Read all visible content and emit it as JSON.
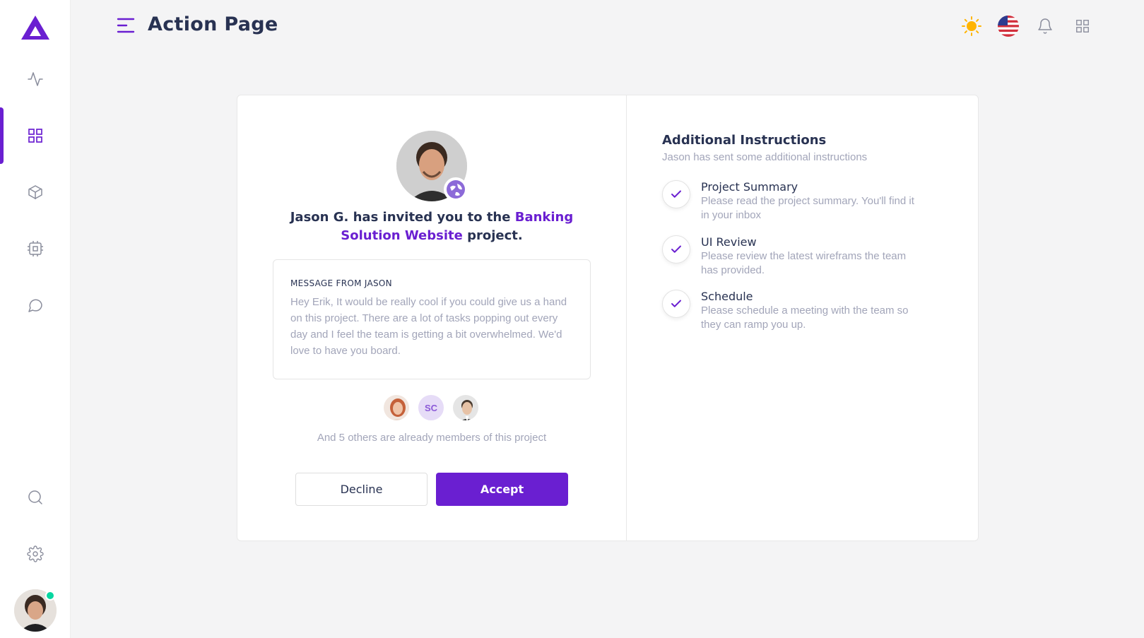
{
  "header": {
    "title": "Action Page"
  },
  "sidebar": {
    "items": [
      {
        "name": "activity",
        "icon": "activity-icon"
      },
      {
        "name": "dashboard",
        "icon": "grid-icon",
        "active": true
      },
      {
        "name": "box",
        "icon": "box-icon"
      },
      {
        "name": "cpu",
        "icon": "cpu-icon"
      },
      {
        "name": "messages",
        "icon": "message-circle-icon"
      }
    ],
    "bottom_items": [
      {
        "name": "search",
        "icon": "search-icon"
      },
      {
        "name": "settings",
        "icon": "settings-icon"
      }
    ]
  },
  "invite": {
    "text_before": "Jason G. has invited you to the ",
    "project_link": "Banking Solution Website",
    "text_after": " project."
  },
  "message": {
    "label": "MESSAGE FROM JASON",
    "body": "Hey Erik, It would be really cool if you could give us a hand on this project. There are a lot of tasks popping out every day and I feel the team is getting a bit overwhelmed. We'd love to have you board."
  },
  "members": {
    "initials": "SC",
    "text": "And 5 others are already members of this project"
  },
  "actions": {
    "decline_label": "Decline",
    "accept_label": "Accept"
  },
  "instructions": {
    "title": "Additional Instructions",
    "subtitle": "Jason has sent some additional instructions",
    "items": [
      {
        "name": "Project Summary",
        "desc": "Please read the project summary. You'll find it in your inbox"
      },
      {
        "name": "UI Review",
        "desc": "Please review the latest wireframs the team has provided."
      },
      {
        "name": "Schedule",
        "desc": "Please schedule a meeting with the team so they can ramp you up."
      }
    ]
  },
  "colors": {
    "accent": "#6a1fd1",
    "text": "#283252",
    "muted": "#a2a5b9",
    "online": "#06d6a0",
    "sun": "#ffb400"
  }
}
